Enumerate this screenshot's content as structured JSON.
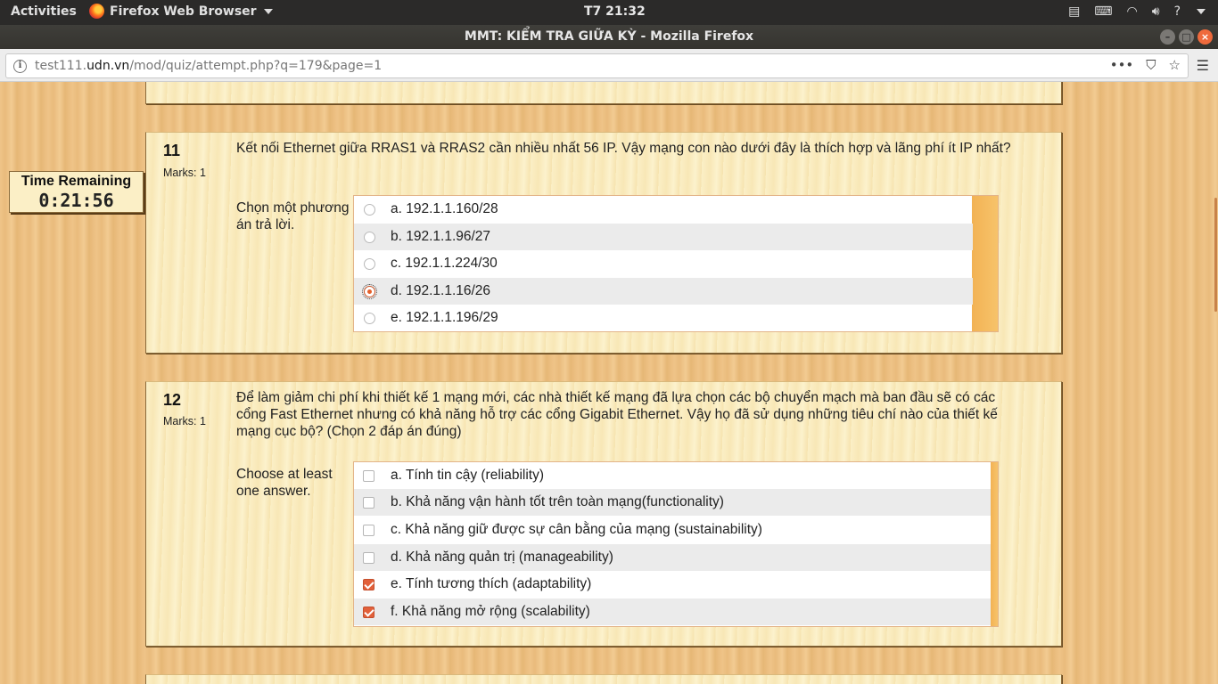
{
  "system_bar": {
    "activities": "Activities",
    "app_name": "Firefox Web Browser",
    "clock": "T7 21:32"
  },
  "window": {
    "title": "MMT: KIỂM TRA GIỮA KỲ - Mozilla Firefox"
  },
  "browser": {
    "url_host_prefix": "test111.",
    "url_host_domain": "udn.vn",
    "url_path": "/mod/quiz/attempt.php?q=179&page=1"
  },
  "timer": {
    "label": "Time Remaining",
    "value": "0:21:56"
  },
  "questions": [
    {
      "number": "11",
      "marks": "Marks: 1",
      "text": "Kết nối Ethernet giữa RRAS1 và RRAS2 cần nhiều nhất 56 IP. Vậy mạng con nào dưới đây là thích hợp và lãng phí ít IP nhất?",
      "prompt": "Chọn một phương án trả lời.",
      "type": "radio",
      "options": [
        {
          "label": "a. 192.1.1.160/28",
          "selected": false
        },
        {
          "label": "b. 192.1.1.96/27",
          "selected": false
        },
        {
          "label": "c. 192.1.1.224/30",
          "selected": false
        },
        {
          "label": "d. 192.1.1.16/26",
          "selected": true
        },
        {
          "label": "e. 192.1.1.196/29",
          "selected": false
        }
      ]
    },
    {
      "number": "12",
      "marks": "Marks: 1",
      "text": "Để làm giảm chi phí khi thiết kế 1 mạng mới, các nhà thiết kế mạng đã lựa chọn các bộ chuyển mạch mà ban đầu sẽ có các cổng Fast Ethernet nhưng có khả năng hỗ trợ các cổng Gigabit Ethernet. Vậy họ đã sử dụng những tiêu chí nào của thiết kế mạng cục bộ? (Chọn 2 đáp án đúng)",
      "prompt": "Choose at least one answer.",
      "type": "checkbox",
      "options": [
        {
          "label": "a. Tính tin cậy (reliability)",
          "selected": false
        },
        {
          "label": "b. Khả năng vận hành tốt trên toàn mạng(functionality)",
          "selected": false
        },
        {
          "label": "c. Khả năng giữ được sự cân bằng của mạng (sustainability)",
          "selected": false
        },
        {
          "label": "d. Khả năng quản trị (manageability)",
          "selected": false
        },
        {
          "label": "e. Tính tương thích (adaptability)",
          "selected": true
        },
        {
          "label": "f. Khả năng mở rộng (scalability)",
          "selected": true
        }
      ]
    }
  ]
}
